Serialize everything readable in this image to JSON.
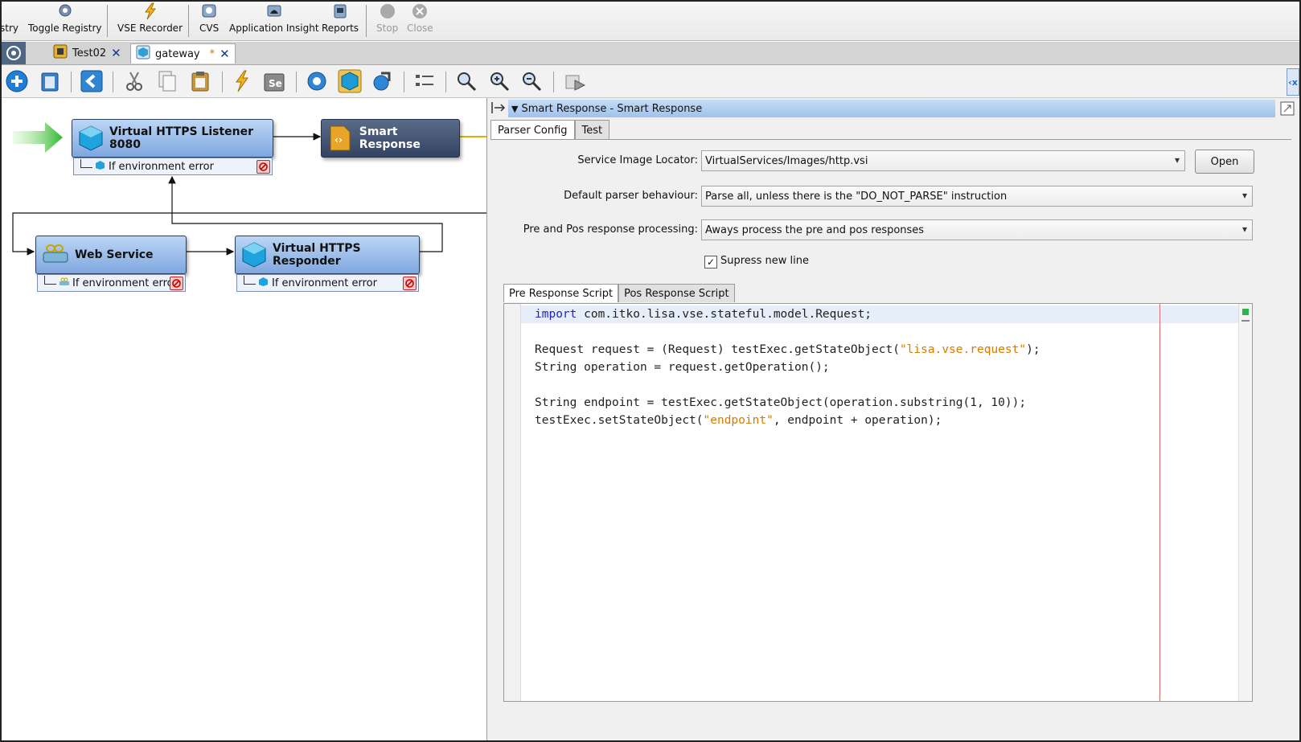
{
  "top_toolbar": {
    "items": [
      {
        "label": "stry",
        "icon": "registry-icon"
      },
      {
        "label": "Toggle Registry",
        "icon": "toggle-registry-icon"
      },
      {
        "label": "VSE Recorder",
        "icon": "lightning-icon"
      },
      {
        "label": "CVS",
        "icon": "cvs-icon"
      },
      {
        "label": "Application Insight",
        "icon": "application-insight-icon"
      },
      {
        "label": "Reports",
        "icon": "reports-icon"
      },
      {
        "label": "Stop",
        "icon": "stop-icon",
        "disabled": true
      },
      {
        "label": "Close",
        "icon": "close-circle-icon",
        "disabled": true
      }
    ]
  },
  "editor_tabs": [
    {
      "label": "Test02",
      "icon": "test-case-icon"
    },
    {
      "label": "gateway",
      "icon": "virtual-service-icon",
      "modified_marker": "*",
      "active": true
    }
  ],
  "canvas": {
    "nodes": {
      "listener": {
        "label": "Virtual HTTPS Listener 8080",
        "sub": "If environment error"
      },
      "smart": {
        "label": "Smart Response"
      },
      "webservice": {
        "label": "Web Service",
        "sub": "If environment error"
      },
      "responder": {
        "label": "Virtual HTTPS Responder",
        "sub": "If environment error"
      }
    }
  },
  "panel": {
    "title": "Smart Response - Smart Response",
    "tabs": [
      "Parser Config",
      "Test"
    ],
    "form": {
      "service_image_locator_label": "Service Image Locator:",
      "service_image_locator_value": "VirtualServices/Images/http.vsi",
      "open_button": "Open",
      "default_parser_label": "Default parser behaviour:",
      "default_parser_value": "Parse all, unless there is the \"DO_NOT_PARSE\" instruction",
      "pre_pos_label": "Pre and Pos response processing:",
      "pre_pos_value": "Aways process the pre and pos responses",
      "supress_label": "Supress new line",
      "supress_checked": true
    },
    "script_tabs": [
      "Pre Response Script",
      "Pos Response Script"
    ],
    "code_lines": [
      {
        "parts": [
          {
            "t": "import",
            "c": "kw"
          },
          {
            "t": " com.itko.lisa.vse.stateful.model.Request;",
            "c": ""
          }
        ]
      },
      {
        "parts": []
      },
      {
        "parts": [
          {
            "t": "Request request = (Request) testExec.getStateObject(",
            "c": ""
          },
          {
            "t": "\"lisa.vse.request\"",
            "c": "str"
          },
          {
            "t": ");",
            "c": ""
          }
        ]
      },
      {
        "parts": [
          {
            "t": "String operation = request.getOperation();",
            "c": ""
          }
        ]
      },
      {
        "parts": []
      },
      {
        "parts": [
          {
            "t": "String endpoint = testExec.getStateObject(operation.substring(1, 10));",
            "c": ""
          }
        ]
      },
      {
        "parts": [
          {
            "t": "testExec.setStateObject(",
            "c": ""
          },
          {
            "t": "\"endpoint\"",
            "c": "str"
          },
          {
            "t": ", endpoint + operation);",
            "c": ""
          }
        ]
      }
    ]
  }
}
